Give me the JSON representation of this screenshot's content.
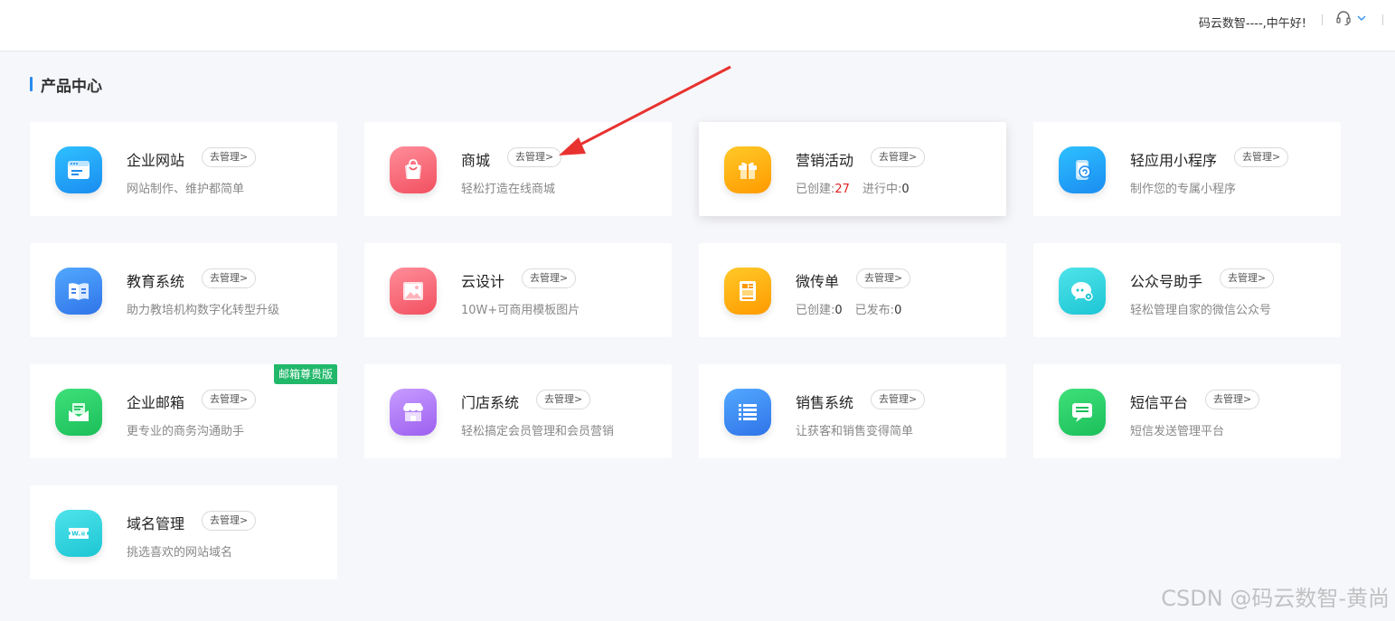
{
  "header": {
    "greeting": "码云数智----,中午好!",
    "support_icon": "headset-icon",
    "menu_icon": "chevron-down-icon"
  },
  "section": {
    "title": "产品中心"
  },
  "manage_label": "去管理>",
  "colors": {
    "accent": "#2a8cf0",
    "badge_green": "#21b86a",
    "count_red": "#e02020"
  },
  "products": [
    {
      "name": "企业网站",
      "desc": "网站制作、维护都简单",
      "icon": "website-icon"
    },
    {
      "name": "商城",
      "desc": "轻松打造在线商城",
      "icon": "shopping-bag-icon"
    },
    {
      "name": "营销活动",
      "icon": "gift-icon",
      "stats": [
        {
          "label": "已创建:",
          "value": "27"
        },
        {
          "label": "进行中:",
          "value": "0"
        }
      ]
    },
    {
      "name": "轻应用小程序",
      "desc": "制作您的专属小程序",
      "icon": "mini-program-icon"
    },
    {
      "name": "教育系统",
      "desc": "助力教培机构数字化转型升级",
      "icon": "book-icon"
    },
    {
      "name": "云设计",
      "desc": "10W+可商用模板图片",
      "icon": "image-icon"
    },
    {
      "name": "微传单",
      "icon": "flyer-icon",
      "stats": [
        {
          "label": "已创建:",
          "value": "0"
        },
        {
          "label": "已发布:",
          "value": "0"
        }
      ]
    },
    {
      "name": "公众号助手",
      "desc": "轻松管理自家的微信公众号",
      "icon": "wechat-icon"
    },
    {
      "name": "企业邮箱",
      "desc": "更专业的商务沟通助手",
      "icon": "mail-icon",
      "badge": "邮箱尊贵版"
    },
    {
      "name": "门店系统",
      "desc": "轻松搞定会员管理和会员营销",
      "icon": "store-icon"
    },
    {
      "name": "销售系统",
      "desc": "让获客和销售变得简单",
      "icon": "list-icon"
    },
    {
      "name": "短信平台",
      "desc": "短信发送管理平台",
      "icon": "sms-icon"
    },
    {
      "name": "域名管理",
      "desc": "挑选喜欢的网站域名",
      "icon": "domain-icon"
    }
  ],
  "watermark": "CSDN @码云数智-黄尚"
}
